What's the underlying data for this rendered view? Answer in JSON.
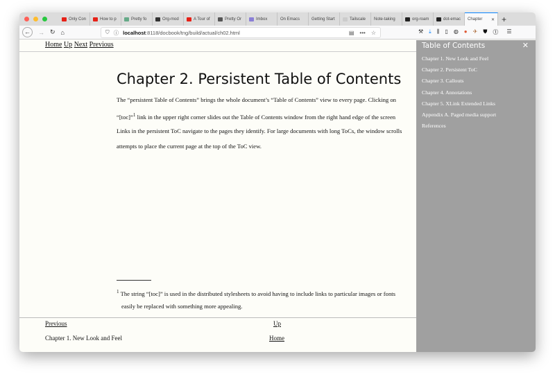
{
  "browser": {
    "tabs": [
      {
        "label": "Only Con",
        "icon": "youtube-icon",
        "color": "#e62117"
      },
      {
        "label": "How to p",
        "icon": "youtube-icon",
        "color": "#e62117"
      },
      {
        "label": "Pretty fo",
        "icon": "bird-icon",
        "color": "#6a8"
      },
      {
        "label": "Org-mod",
        "icon": "org-icon",
        "color": "#333"
      },
      {
        "label": "A Tour of",
        "icon": "youtube-icon",
        "color": "#e62117"
      },
      {
        "label": "Pretty Or",
        "icon": "grid-icon",
        "color": "#555"
      },
      {
        "label": "Imbox",
        "icon": "hey-icon",
        "color": "#8a7fd6"
      },
      {
        "label": "On Emacs",
        "icon": "",
        "color": ""
      },
      {
        "label": "Getting Start",
        "icon": "",
        "color": ""
      },
      {
        "label": "Tailscale",
        "icon": "dots-icon",
        "color": "#ccc"
      },
      {
        "label": "Note-taking",
        "icon": "",
        "color": ""
      },
      {
        "label": "org-roam",
        "icon": "github-icon",
        "color": "#222"
      },
      {
        "label": "dot-emac",
        "icon": "github-icon",
        "color": "#222"
      },
      {
        "label": "Chapter",
        "icon": "",
        "color": "",
        "active": true
      }
    ],
    "url_host": "localhost",
    "url_rest": ":8118/docbook/tng/build/actual/ch02.html"
  },
  "page": {
    "topnav": [
      "Home",
      "Up",
      "Next",
      "Previous"
    ],
    "title": "Chapter 2. Persistent Table of Contents",
    "para1_line1": "The “persistent Table of Contents” brings the whole document’s “Table of Contents” view to every page. Clicking on",
    "para1_line2_a": "“[toc]”",
    "para1_sup": "1",
    "para1_line2_b": " link in the upper right corner slides out the Table of Contents window from the right hand edge of the screen",
    "para2_line1": "Links in the persistent ToC navigate to the pages they identify. For large documents with long ToCs, the window scrolls",
    "para2_line2": "attempts to place the current page at the top of the ToC view.",
    "footnote_mark": "1",
    "footnote_line1": "The string “[toc]” is used in the distributed stylesheets to avoid having to include links to particular images or fonts",
    "footnote_line2": "easily be replaced with something more appealing.",
    "footer": {
      "prev": "Previous",
      "up": "Up",
      "prev_title": "Chapter 1. New Look and Feel",
      "home": "Home"
    }
  },
  "toc": {
    "title": "Table of Contents",
    "items": [
      "Chapter 1. New Look and Feel",
      "Chapter 2. Persistent ToC",
      "Chapter 3. Callouts",
      "Chapter 4. Annotations",
      "Chapter 5. XLink Extended Links",
      "Appendix A. Paged media support",
      "References"
    ]
  }
}
